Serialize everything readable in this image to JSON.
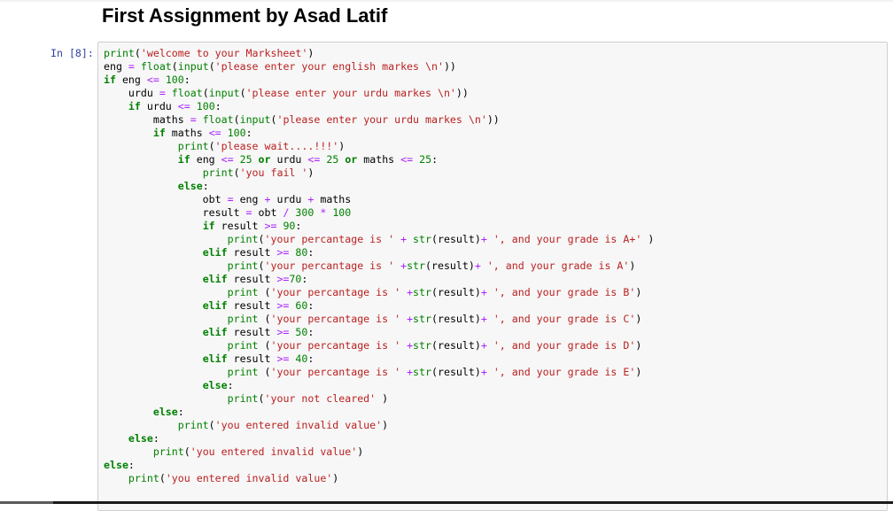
{
  "notebook": {
    "title": "First Assignment by Asad Latif",
    "cell": {
      "prompt": "In [8]:",
      "lines": [
        [
          [
            "n",
            "print"
          ],
          [
            "p",
            "("
          ],
          [
            "s",
            "'welcome to your Marksheet'"
          ],
          [
            "p",
            ")"
          ]
        ],
        [
          [
            "p",
            "eng "
          ],
          [
            "o",
            "="
          ],
          [
            "p",
            " "
          ],
          [
            "n",
            "float"
          ],
          [
            "p",
            "("
          ],
          [
            "n",
            "input"
          ],
          [
            "p",
            "("
          ],
          [
            "s",
            "'please enter your english markes \\n'"
          ],
          [
            "p",
            "))"
          ]
        ],
        [
          [
            "k",
            "if"
          ],
          [
            "p",
            " eng "
          ],
          [
            "o",
            "<="
          ],
          [
            "p",
            " "
          ],
          [
            "m",
            "100"
          ],
          [
            "p",
            ":"
          ]
        ],
        [
          [
            "p",
            "    urdu "
          ],
          [
            "o",
            "="
          ],
          [
            "p",
            " "
          ],
          [
            "n",
            "float"
          ],
          [
            "p",
            "("
          ],
          [
            "n",
            "input"
          ],
          [
            "p",
            "("
          ],
          [
            "s",
            "'please enter your urdu markes \\n'"
          ],
          [
            "p",
            "))"
          ]
        ],
        [
          [
            "p",
            "    "
          ],
          [
            "k",
            "if"
          ],
          [
            "p",
            " urdu "
          ],
          [
            "o",
            "<="
          ],
          [
            "p",
            " "
          ],
          [
            "m",
            "100"
          ],
          [
            "p",
            ":"
          ]
        ],
        [
          [
            "p",
            "        maths "
          ],
          [
            "o",
            "="
          ],
          [
            "p",
            " "
          ],
          [
            "n",
            "float"
          ],
          [
            "p",
            "("
          ],
          [
            "n",
            "input"
          ],
          [
            "p",
            "("
          ],
          [
            "s",
            "'please enter your urdu markes \\n'"
          ],
          [
            "p",
            "))"
          ]
        ],
        [
          [
            "p",
            "        "
          ],
          [
            "k",
            "if"
          ],
          [
            "p",
            " maths "
          ],
          [
            "o",
            "<="
          ],
          [
            "p",
            " "
          ],
          [
            "m",
            "100"
          ],
          [
            "p",
            ":"
          ]
        ],
        [
          [
            "p",
            "            "
          ],
          [
            "n",
            "print"
          ],
          [
            "p",
            "("
          ],
          [
            "s",
            "'please wait....!!!'"
          ],
          [
            "p",
            ")"
          ]
        ],
        [
          [
            "p",
            "            "
          ],
          [
            "k",
            "if"
          ],
          [
            "p",
            " eng "
          ],
          [
            "o",
            "<="
          ],
          [
            "p",
            " "
          ],
          [
            "m",
            "25"
          ],
          [
            "p",
            " "
          ],
          [
            "k",
            "or"
          ],
          [
            "p",
            " urdu "
          ],
          [
            "o",
            "<="
          ],
          [
            "p",
            " "
          ],
          [
            "m",
            "25"
          ],
          [
            "p",
            " "
          ],
          [
            "k",
            "or"
          ],
          [
            "p",
            " maths "
          ],
          [
            "o",
            "<="
          ],
          [
            "p",
            " "
          ],
          [
            "m",
            "25"
          ],
          [
            "p",
            ":"
          ]
        ],
        [
          [
            "p",
            "                "
          ],
          [
            "n",
            "print"
          ],
          [
            "p",
            "("
          ],
          [
            "s",
            "'you fail '"
          ],
          [
            "p",
            ")"
          ]
        ],
        [
          [
            "p",
            "            "
          ],
          [
            "k",
            "else"
          ],
          [
            "p",
            ":"
          ]
        ],
        [
          [
            "p",
            "                obt "
          ],
          [
            "o",
            "="
          ],
          [
            "p",
            " eng "
          ],
          [
            "o",
            "+"
          ],
          [
            "p",
            " urdu "
          ],
          [
            "o",
            "+"
          ],
          [
            "p",
            " maths"
          ]
        ],
        [
          [
            "p",
            "                result "
          ],
          [
            "o",
            "="
          ],
          [
            "p",
            " obt "
          ],
          [
            "o",
            "/"
          ],
          [
            "p",
            " "
          ],
          [
            "m",
            "300"
          ],
          [
            "p",
            " "
          ],
          [
            "o",
            "*"
          ],
          [
            "p",
            " "
          ],
          [
            "m",
            "100"
          ]
        ],
        [
          [
            "p",
            "                "
          ],
          [
            "k",
            "if"
          ],
          [
            "p",
            " result "
          ],
          [
            "o",
            ">="
          ],
          [
            "p",
            " "
          ],
          [
            "m",
            "90"
          ],
          [
            "p",
            ":"
          ]
        ],
        [
          [
            "p",
            "                    "
          ],
          [
            "n",
            "print"
          ],
          [
            "p",
            "("
          ],
          [
            "s",
            "'your percantage is '"
          ],
          [
            "p",
            " "
          ],
          [
            "o",
            "+"
          ],
          [
            "p",
            " "
          ],
          [
            "n",
            "str"
          ],
          [
            "p",
            "(result)"
          ],
          [
            "o",
            "+"
          ],
          [
            "p",
            " "
          ],
          [
            "s",
            "', and your grade is A+'"
          ],
          [
            "p",
            " )"
          ]
        ],
        [
          [
            "p",
            "                "
          ],
          [
            "k",
            "elif"
          ],
          [
            "p",
            " result "
          ],
          [
            "o",
            ">="
          ],
          [
            "p",
            " "
          ],
          [
            "m",
            "80"
          ],
          [
            "p",
            ":"
          ]
        ],
        [
          [
            "p",
            "                    "
          ],
          [
            "n",
            "print"
          ],
          [
            "p",
            "("
          ],
          [
            "s",
            "'your percantage is '"
          ],
          [
            "p",
            " "
          ],
          [
            "o",
            "+"
          ],
          [
            "n",
            "str"
          ],
          [
            "p",
            "(result)"
          ],
          [
            "o",
            "+"
          ],
          [
            "p",
            " "
          ],
          [
            "s",
            "', and your grade is A'"
          ],
          [
            "p",
            ")"
          ]
        ],
        [
          [
            "p",
            "                "
          ],
          [
            "k",
            "elif"
          ],
          [
            "p",
            " result "
          ],
          [
            "o",
            ">="
          ],
          [
            "m",
            "70"
          ],
          [
            "p",
            ":"
          ]
        ],
        [
          [
            "p",
            "                    "
          ],
          [
            "n",
            "print"
          ],
          [
            "p",
            " ("
          ],
          [
            "s",
            "'your percantage is '"
          ],
          [
            "p",
            " "
          ],
          [
            "o",
            "+"
          ],
          [
            "n",
            "str"
          ],
          [
            "p",
            "(result)"
          ],
          [
            "o",
            "+"
          ],
          [
            "p",
            " "
          ],
          [
            "s",
            "', and your grade is B'"
          ],
          [
            "p",
            ")"
          ]
        ],
        [
          [
            "p",
            "                "
          ],
          [
            "k",
            "elif"
          ],
          [
            "p",
            " result "
          ],
          [
            "o",
            ">="
          ],
          [
            "p",
            " "
          ],
          [
            "m",
            "60"
          ],
          [
            "p",
            ":"
          ]
        ],
        [
          [
            "p",
            "                    "
          ],
          [
            "n",
            "print"
          ],
          [
            "p",
            " ("
          ],
          [
            "s",
            "'your percantage is '"
          ],
          [
            "p",
            " "
          ],
          [
            "o",
            "+"
          ],
          [
            "n",
            "str"
          ],
          [
            "p",
            "(result)"
          ],
          [
            "o",
            "+"
          ],
          [
            "p",
            " "
          ],
          [
            "s",
            "', and your grade is C'"
          ],
          [
            "p",
            ")"
          ]
        ],
        [
          [
            "p",
            "                "
          ],
          [
            "k",
            "elif"
          ],
          [
            "p",
            " result "
          ],
          [
            "o",
            ">="
          ],
          [
            "p",
            " "
          ],
          [
            "m",
            "50"
          ],
          [
            "p",
            ":"
          ]
        ],
        [
          [
            "p",
            "                    "
          ],
          [
            "n",
            "print"
          ],
          [
            "p",
            " ("
          ],
          [
            "s",
            "'your percantage is '"
          ],
          [
            "p",
            " "
          ],
          [
            "o",
            "+"
          ],
          [
            "n",
            "str"
          ],
          [
            "p",
            "(result)"
          ],
          [
            "o",
            "+"
          ],
          [
            "p",
            " "
          ],
          [
            "s",
            "', and your grade is D'"
          ],
          [
            "p",
            ")"
          ]
        ],
        [
          [
            "p",
            "                "
          ],
          [
            "k",
            "elif"
          ],
          [
            "p",
            " result "
          ],
          [
            "o",
            ">="
          ],
          [
            "p",
            " "
          ],
          [
            "m",
            "40"
          ],
          [
            "p",
            ":"
          ]
        ],
        [
          [
            "p",
            "                    "
          ],
          [
            "n",
            "print"
          ],
          [
            "p",
            " ("
          ],
          [
            "s",
            "'your percantage is '"
          ],
          [
            "p",
            " "
          ],
          [
            "o",
            "+"
          ],
          [
            "n",
            "str"
          ],
          [
            "p",
            "(result)"
          ],
          [
            "o",
            "+"
          ],
          [
            "p",
            " "
          ],
          [
            "s",
            "', and your grade is E'"
          ],
          [
            "p",
            ")"
          ]
        ],
        [
          [
            "p",
            "                "
          ],
          [
            "k",
            "else"
          ],
          [
            "p",
            ":"
          ]
        ],
        [
          [
            "p",
            "                    "
          ],
          [
            "n",
            "print"
          ],
          [
            "p",
            "("
          ],
          [
            "s",
            "'your not cleared'"
          ],
          [
            "p",
            " )"
          ]
        ],
        [
          [
            "p",
            "        "
          ],
          [
            "k",
            "else"
          ],
          [
            "p",
            ":"
          ]
        ],
        [
          [
            "p",
            "            "
          ],
          [
            "n",
            "print"
          ],
          [
            "p",
            "("
          ],
          [
            "s",
            "'you entered invalid value'"
          ],
          [
            "p",
            ")"
          ]
        ],
        [
          [
            "p",
            "    "
          ],
          [
            "k",
            "else"
          ],
          [
            "p",
            ":"
          ]
        ],
        [
          [
            "p",
            "        "
          ],
          [
            "n",
            "print"
          ],
          [
            "p",
            "("
          ],
          [
            "s",
            "'you entered invalid value'"
          ],
          [
            "p",
            ")"
          ]
        ],
        [
          [
            "k",
            "else"
          ],
          [
            "p",
            ":"
          ]
        ],
        [
          [
            "p",
            "    "
          ],
          [
            "n",
            "print"
          ],
          [
            "p",
            "("
          ],
          [
            "s",
            "'you entered invalid value'"
          ],
          [
            "p",
            ")"
          ]
        ]
      ]
    }
  },
  "colors": {
    "keyword": "#008000",
    "builtin": "#008000",
    "string": "#ba2121",
    "operator": "#aa22ff",
    "number": "#008000",
    "prompt": "#303f9f",
    "cell_background": "#f7f7f7",
    "cell_border": "#cfcfcf"
  }
}
